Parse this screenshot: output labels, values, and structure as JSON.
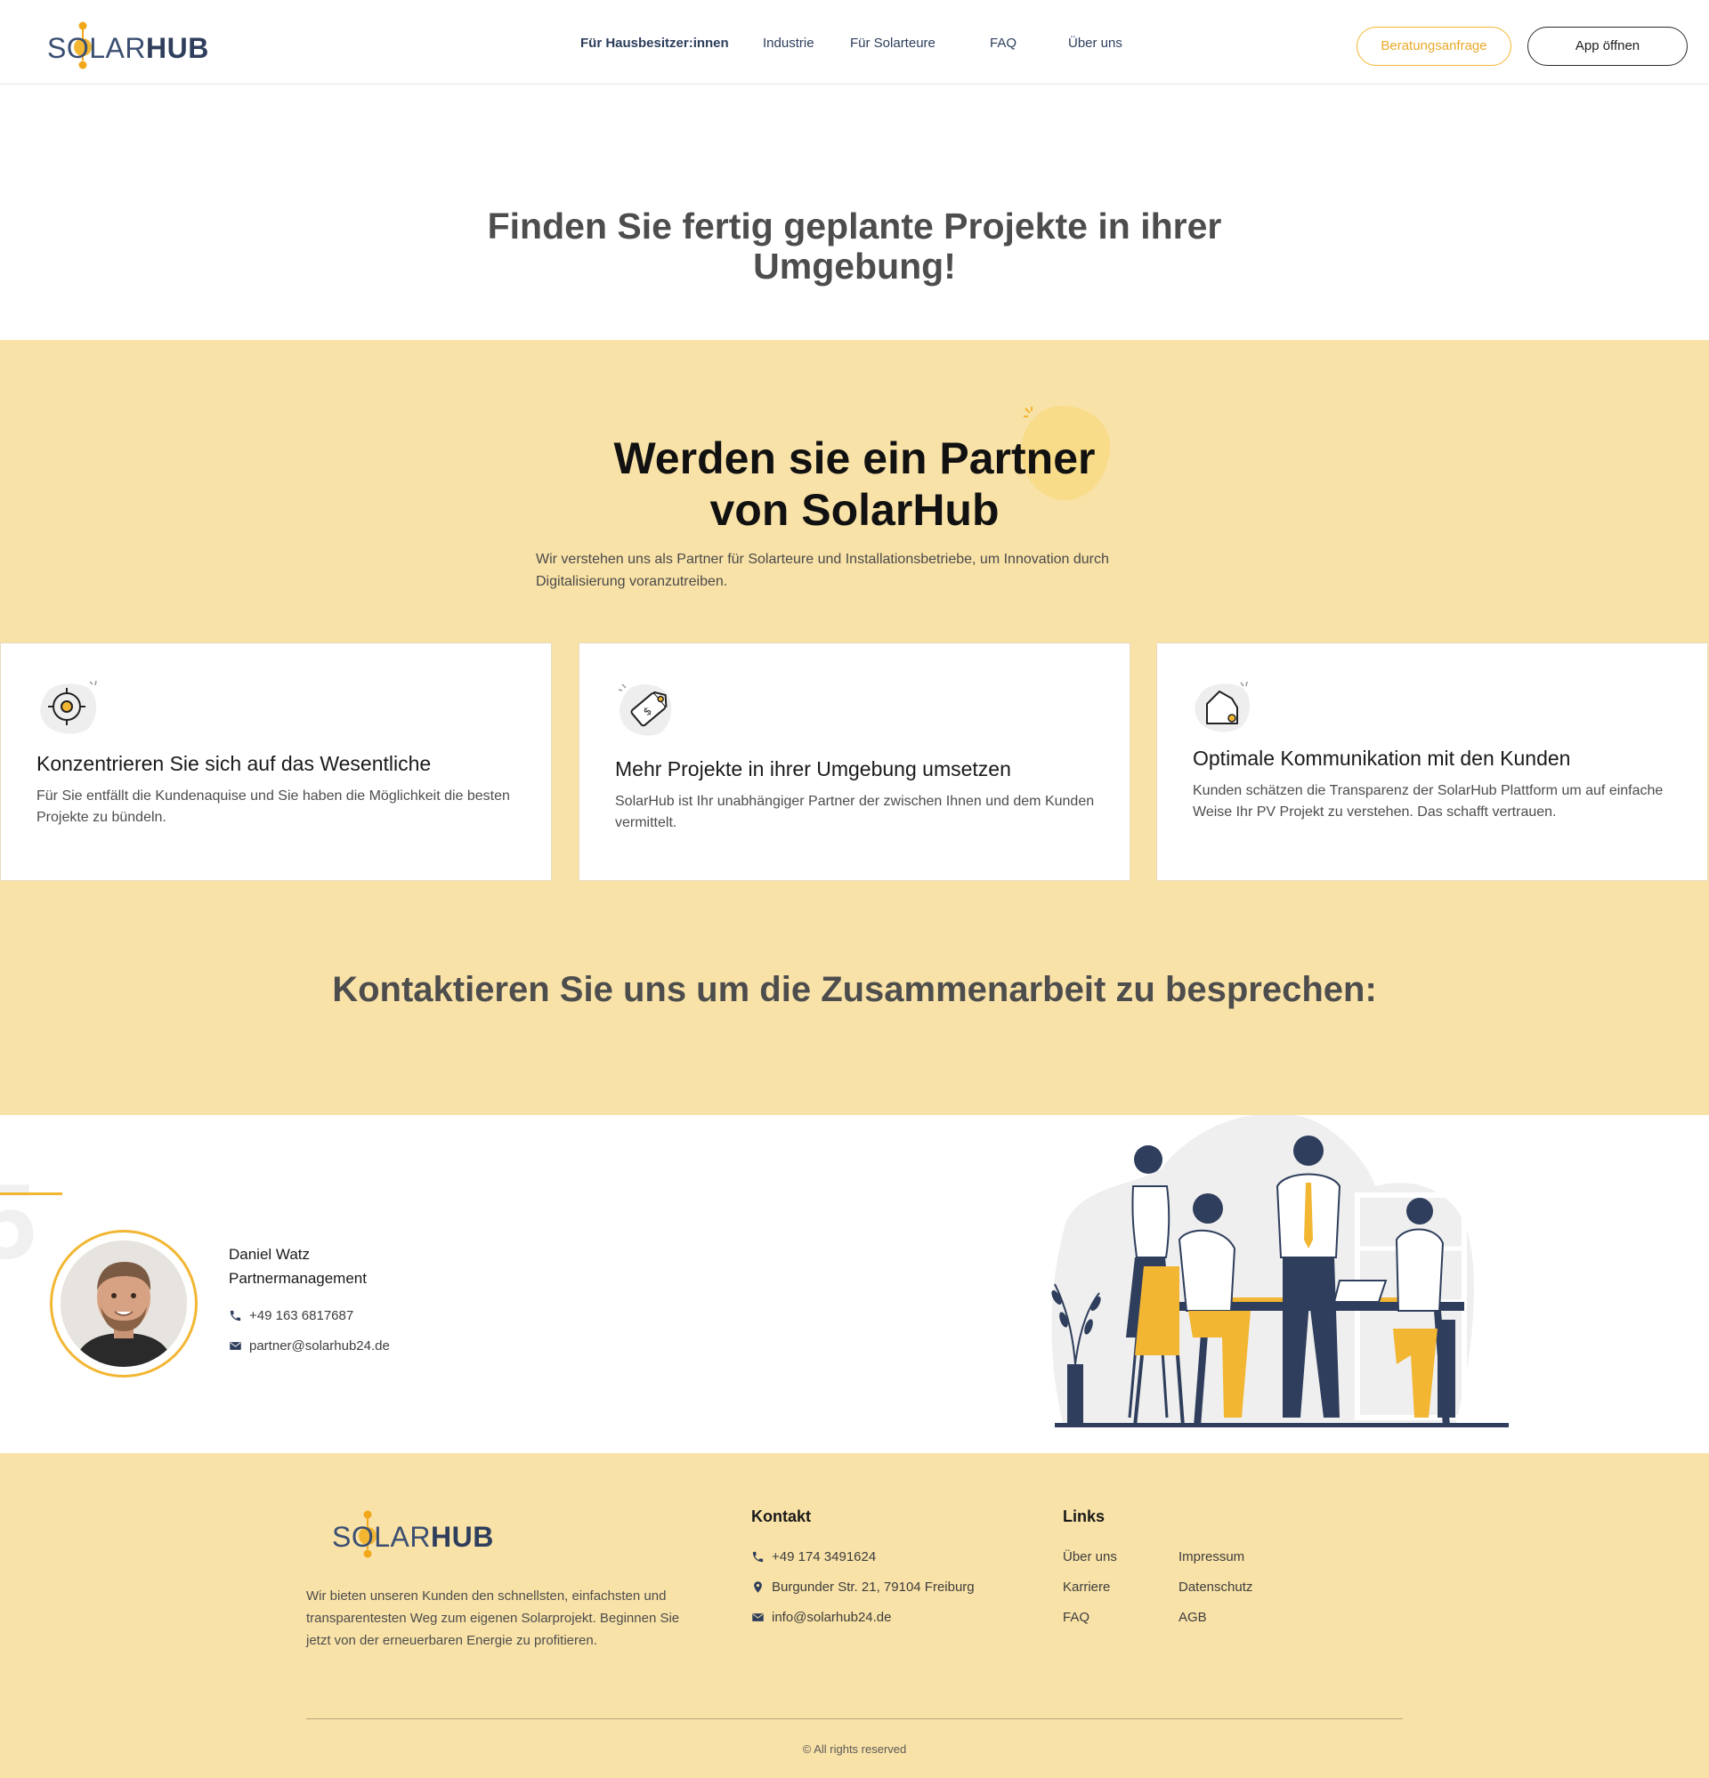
{
  "brand": {
    "logo_prefix": "SOLAR",
    "logo_suffix": "HUB",
    "primary": "#f2b632",
    "navy": "#2f3e5c",
    "background_soft": "#f9e2a7"
  },
  "nav": {
    "items": [
      {
        "label": "Für Hausbesitzer:innen",
        "active": true
      },
      {
        "label": "Industrie"
      },
      {
        "label": "Für Solarteure"
      },
      {
        "label": "FAQ"
      },
      {
        "label": "Über uns"
      }
    ],
    "consult_button": "Beratungsanfrage",
    "app_button": "App öffnen"
  },
  "hero": {
    "title": "Finden Sie fertig geplante Projekte in ihrer Umgebung!"
  },
  "partner": {
    "title_line1": "Werden sie ein Partner",
    "title_line2": "von SolarHub",
    "subtitle": "Wir verstehen uns als Partner für Solarteure und Installationsbetriebe, um Innovation durch Digitalisierung voranzutreiben.",
    "cards": [
      {
        "icon": "target-icon",
        "title": "Konzentrieren Sie sich auf das Wesentliche",
        "text": "Für Sie entfällt die Kundenaquise und Sie haben die Möglichkeit die besten Projekte zu bündeln."
      },
      {
        "icon": "price-tag-icon",
        "title": "Mehr Projekte in ihrer Umgebung umsetzen",
        "text": "SolarHub ist Ihr unabhängiger Partner der zwischen Ihnen und dem Kunden vermittelt."
      },
      {
        "icon": "house-icon",
        "title": "Optimale Kommunikation mit den Kunden",
        "text": "Kunden schätzen die Transparenz der SolarHub Plattform um auf einfache Weise Ihr PV Projekt zu verstehen. Das schafft vertrauen."
      }
    ],
    "contact_heading": "Kontaktieren Sie uns um die Zusammenarbeit zu besprechen:"
  },
  "contact_person": {
    "name": "Daniel Watz",
    "role": "Partnermanagement",
    "phone": "+49 163 6817687",
    "email": "partner@solarhub24.de"
  },
  "footer": {
    "about": "Wir bieten unseren Kunden den schnellsten, einfachsten und transparentesten Weg zum eigenen Solarprojekt. Beginnen Sie jetzt von der erneuerbaren Energie zu profitieren.",
    "contact_heading": "Kontakt",
    "phone": "+49 174 3491624",
    "address": "Burgunder Str. 21, 79104 Freiburg",
    "email": "info@solarhub24.de",
    "links_heading": "Links",
    "links_col1": [
      "Über uns",
      "Karriere",
      "FAQ"
    ],
    "links_col2": [
      "Impressum",
      "Datenschutz",
      "AGB"
    ],
    "copyright": "© All rights reserved"
  }
}
